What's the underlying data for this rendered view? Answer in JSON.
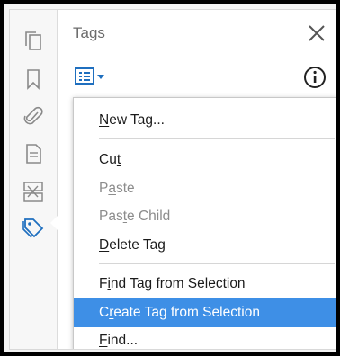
{
  "panel": {
    "title": "Tags"
  },
  "left_rail": {
    "icons": [
      "pages-icon",
      "bookmark-icon",
      "attachment-icon",
      "document-icon",
      "content-icon",
      "tag-icon"
    ],
    "active": "tag-icon"
  },
  "menu": {
    "items": [
      {
        "label": "New Tag...",
        "mnemonic_index": 0,
        "enabled": true,
        "highlighted": false
      },
      {
        "label": "Cut",
        "mnemonic_index": 2,
        "enabled": true,
        "highlighted": false
      },
      {
        "label": "Paste",
        "mnemonic_index": 1,
        "enabled": false,
        "highlighted": false
      },
      {
        "label": "Paste Child",
        "mnemonic_index": 3,
        "enabled": false,
        "highlighted": false
      },
      {
        "label": "Delete Tag",
        "mnemonic_index": 0,
        "enabled": true,
        "highlighted": false
      },
      {
        "label": "Find Tag from Selection",
        "mnemonic_index": 1,
        "enabled": true,
        "highlighted": false
      },
      {
        "label": "Create Tag from Selection",
        "mnemonic_index": 1,
        "enabled": true,
        "highlighted": true
      },
      {
        "label": "Find...",
        "mnemonic_index": 0,
        "enabled": true,
        "highlighted": false
      }
    ]
  },
  "colors": {
    "accent_blue": "#1f6fbf",
    "highlight": "#3e8fe6",
    "disabled_text": "#8c8c8c"
  }
}
